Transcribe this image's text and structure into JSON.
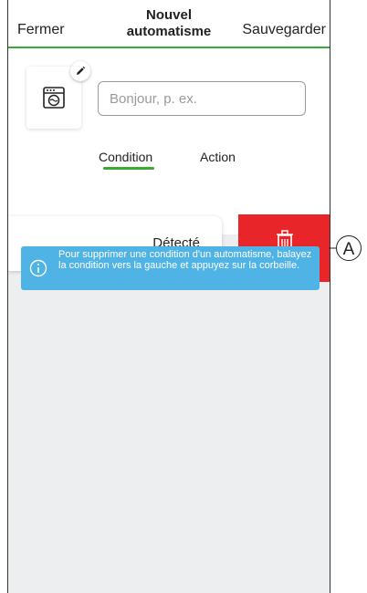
{
  "header": {
    "close_label": "Fermer",
    "title_line1": "Nouvel",
    "title_line2": "automatisme",
    "save_label": "Sauvegarder"
  },
  "name_input": {
    "placeholder": "Bonjour, p. ex.",
    "value": ""
  },
  "icons": {
    "appliance": "washing-machine-icon",
    "edit": "pencil-icon",
    "delete": "trash-icon",
    "info": "info-icon"
  },
  "tabs": [
    {
      "label": "Condition",
      "active": true
    },
    {
      "label": "Action",
      "active": false
    }
  ],
  "condition": {
    "state_label": "Détecté"
  },
  "info_banner": {
    "text": "Pour supprimer une condition d'un automatisme, balayez la condition vers la gauche et appuyez sur la corbeille."
  },
  "callout": {
    "label": "A"
  },
  "colors": {
    "accent_green": "#3aaa35",
    "delete_red": "#e8262a",
    "info_blue": "#4fb3e6",
    "panel_gray": "#eceeef"
  }
}
